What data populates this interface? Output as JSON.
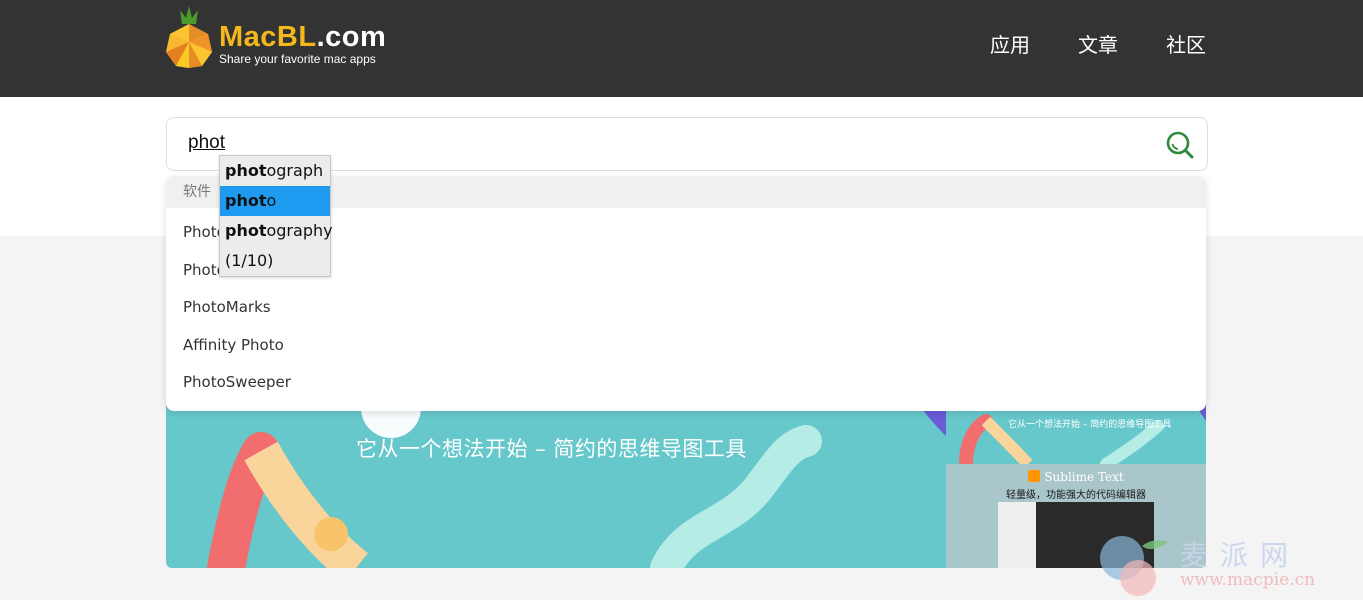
{
  "header": {
    "logo_text_main": "MacBL",
    "logo_text_dot": ".com",
    "logo_tagline": "Share your favorite mac apps",
    "nav": [
      "应用",
      "文章",
      "社区"
    ]
  },
  "search": {
    "value": "phot"
  },
  "dropdown": {
    "category": "软件",
    "items": [
      "PhotoScape X",
      "Photolemur",
      "PhotoMarks",
      "Affinity Photo",
      "PhotoSweeper"
    ]
  },
  "suggestions": {
    "items": [
      {
        "bold": "phot",
        "rest": "ograph"
      },
      {
        "bold": "phot",
        "rest": "o"
      },
      {
        "bold": "phot",
        "rest": "ography"
      }
    ],
    "selected_index": 1,
    "count": "(1/10)"
  },
  "banner": {
    "tagline": "它从一个想法开始 – 简约的思维导图工具",
    "side_top_text": "它从一个想法开始 – 简约的思维导图工具",
    "side_card_title": "Sublime Text",
    "side_card_subtitle": "轻量级，功能强大的代码编辑器"
  },
  "watermark": {
    "text": "麦派网",
    "url": "www.macpie.cn"
  },
  "colors": {
    "header_bg": "#333333",
    "logo_yellow": "#f5b81c",
    "banner_teal": "#67c8cc",
    "selection_blue": "#1e9bf0",
    "search_icon_green": "#2e8b3a"
  },
  "icons": {
    "logo": "pineapple-logo-icon",
    "search": "search-icon"
  }
}
